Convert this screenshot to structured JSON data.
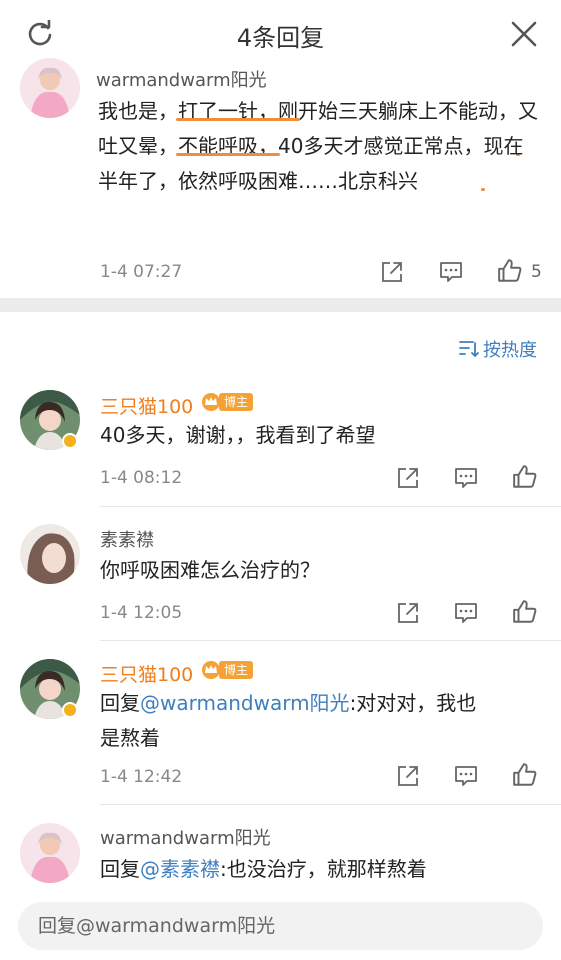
{
  "header": {
    "title": "4条回复"
  },
  "post": {
    "username": "warmandwarm阳光",
    "content_parts": [
      "我也是，",
      "打了一针，",
      "刚",
      "开始三天躺床上不能动，",
      "又吐又晕，",
      "不能呼吸，",
      "40多天才感觉正常点，",
      "现在半年了，依然呼吸困难",
      "……北京科兴"
    ],
    "timestamp": "1-4 07:27",
    "like_count": "5"
  },
  "sort": {
    "label": "按热度"
  },
  "replies": [
    {
      "username": "三只猫100",
      "badge": "博主",
      "content": "40多天，谢谢，，我看到了希望",
      "timestamp": "1-4 08:12"
    },
    {
      "username": "素素襟",
      "content": "你呼吸困难怎么治疗的？",
      "timestamp": "1-4 12:05"
    },
    {
      "username": "三只猫100",
      "badge": "博主",
      "reply_prefix": "回复",
      "mention": "@warmandwarm阳光",
      "content_line1_rest": ":对对对，我也",
      "content_line2": "是熬着",
      "timestamp": "1-4 12:42"
    },
    {
      "username": "warmandwarm阳光",
      "reply_prefix": "回复",
      "mention": "@素素襟",
      "content_rest": ":也没治疗，就那样熬着"
    }
  ],
  "reply_input": {
    "placeholder": "回复@warmandwarm阳光"
  },
  "colors": {
    "orange_name": "#f07e1d",
    "link_blue": "#3f7fbf",
    "highlight_underline": "#f08d3c",
    "badge_bg": "#f3a233"
  },
  "icons": [
    "refresh-icon",
    "close-icon",
    "share-icon",
    "comment-icon",
    "like-icon",
    "sort-icon",
    "crown-icon",
    "verified-icon"
  ]
}
